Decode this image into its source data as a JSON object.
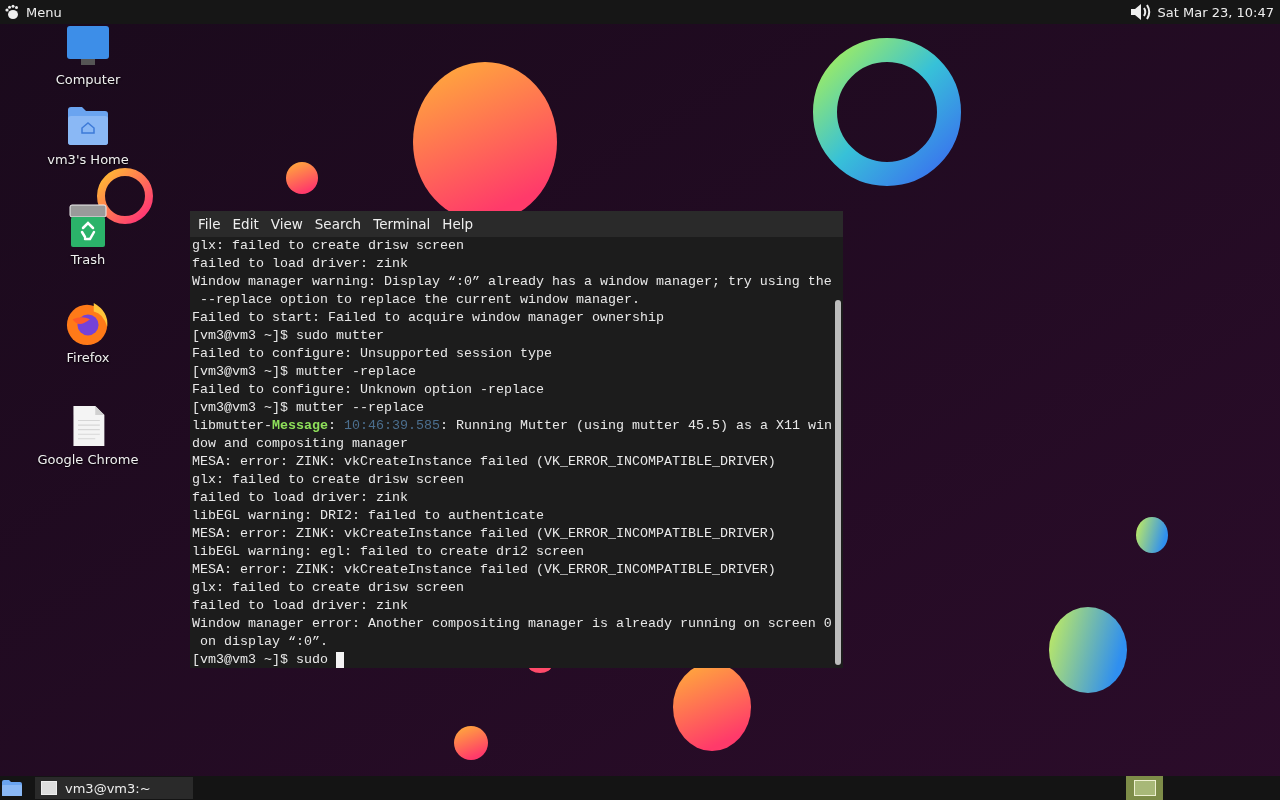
{
  "top_panel": {
    "menu_label": "Menu",
    "clock": "Sat Mar 23, 10:47"
  },
  "desktop_icons": [
    {
      "label": "Computer",
      "kind": "computer"
    },
    {
      "label": "vm3's Home",
      "kind": "home"
    },
    {
      "label": "Trash",
      "kind": "trash"
    },
    {
      "label": "Firefox",
      "kind": "firefox"
    },
    {
      "label": "Google Chrome",
      "kind": "document"
    }
  ],
  "terminal": {
    "menu": [
      "File",
      "Edit",
      "View",
      "Search",
      "Terminal",
      "Help"
    ],
    "lines": [
      {
        "text": "glx: failed to create drisw screen"
      },
      {
        "text": "failed to load driver: zink"
      },
      {
        "text": "Window manager warning: Display “:0” already has a window manager; try using the"
      },
      {
        "text": " --replace option to replace the current window manager."
      },
      {
        "text": "Failed to start: Failed to acquire window manager ownership"
      },
      {
        "text": "[vm3@vm3 ~]$ sudo mutter"
      },
      {
        "text": "Failed to configure: Unsupported session type"
      },
      {
        "text": "[vm3@vm3 ~]$ mutter -replace"
      },
      {
        "text": "Failed to configure: Unknown option -replace"
      },
      {
        "text": "[vm3@vm3 ~]$ mutter --replace"
      },
      {
        "parts": [
          {
            "text": "libmutter-",
            "kind": "plain"
          },
          {
            "text": "Message",
            "kind": "level"
          },
          {
            "text": ": ",
            "kind": "plain"
          },
          {
            "text": "10:46:39.585",
            "kind": "timestamp"
          },
          {
            "text": ": Running Mutter (using mutter 45.5) as a X11 win",
            "kind": "plain"
          }
        ]
      },
      {
        "text": "dow and compositing manager"
      },
      {
        "text": "MESA: error: ZINK: vkCreateInstance failed (VK_ERROR_INCOMPATIBLE_DRIVER)"
      },
      {
        "text": "glx: failed to create drisw screen"
      },
      {
        "text": "failed to load driver: zink"
      },
      {
        "text": "libEGL warning: DRI2: failed to authenticate"
      },
      {
        "text": "MESA: error: ZINK: vkCreateInstance failed (VK_ERROR_INCOMPATIBLE_DRIVER)"
      },
      {
        "text": "libEGL warning: egl: failed to create dri2 screen"
      },
      {
        "text": "MESA: error: ZINK: vkCreateInstance failed (VK_ERROR_INCOMPATIBLE_DRIVER)"
      },
      {
        "text": "glx: failed to create drisw screen"
      },
      {
        "text": "failed to load driver: zink"
      },
      {
        "text": "Window manager error: Another compositing manager is already running on screen 0"
      },
      {
        "text": " on display “:0”."
      },
      {
        "text": "[vm3@vm3 ~]$ sudo ",
        "cursor": true
      }
    ]
  },
  "taskbar": {
    "tasks": [
      {
        "label": "vm3@vm3:~"
      }
    ],
    "workspaces": [
      {
        "selected": true
      }
    ]
  }
}
